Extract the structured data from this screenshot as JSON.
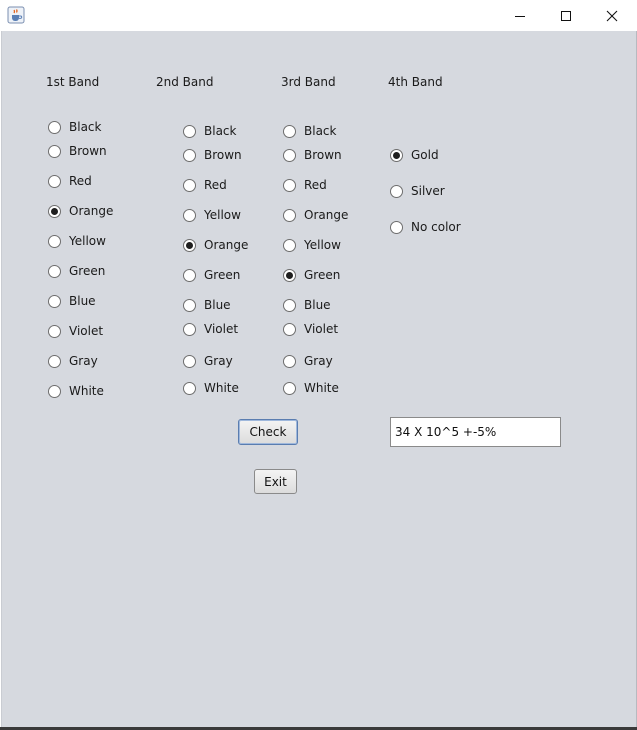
{
  "window": {
    "icon": "java-cup-icon",
    "controls": [
      "minimize-icon",
      "maximize-icon",
      "close-icon"
    ]
  },
  "bands": [
    {
      "title": "1st Band",
      "options": [
        "Black",
        "Brown",
        "Red",
        "Orange",
        "Yellow",
        "Green",
        "Blue",
        "Violet",
        "Gray",
        "White"
      ],
      "selected": "Orange"
    },
    {
      "title": "2nd Band",
      "options": [
        "Black",
        "Brown",
        "Red",
        "Yellow",
        "Orange",
        "Green",
        "Blue",
        "Violet",
        "Gray",
        "White"
      ],
      "selected": "Orange"
    },
    {
      "title": "3rd Band",
      "options": [
        "Black",
        "Brown",
        "Red",
        "Orange",
        "Yellow",
        "Green",
        "Blue",
        "Violet",
        "Gray",
        "White"
      ],
      "selected": "Green"
    },
    {
      "title": "4th Band",
      "options": [
        "Gold",
        "Silver",
        "No color"
      ],
      "selected": "Gold"
    }
  ],
  "actions": {
    "check_label": "Check",
    "exit_label": "Exit"
  },
  "result": {
    "value": "34 X 10^5 +-5%"
  }
}
